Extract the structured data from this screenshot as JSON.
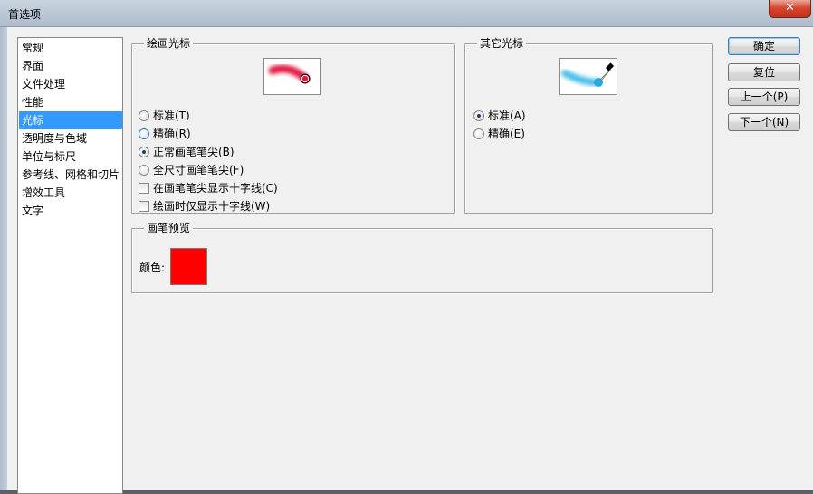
{
  "window": {
    "title": "首选项",
    "close_label": "✕"
  },
  "nav": {
    "items": [
      {
        "label": "常规"
      },
      {
        "label": "界面"
      },
      {
        "label": "文件处理"
      },
      {
        "label": "性能"
      },
      {
        "label": "光标"
      },
      {
        "label": "透明度与色域"
      },
      {
        "label": "单位与标尺"
      },
      {
        "label": "参考线、网格和切片"
      },
      {
        "label": "增效工具"
      },
      {
        "label": "文字"
      }
    ],
    "selected": "光标"
  },
  "painting_cursors": {
    "label": "绘画光标",
    "options": [
      {
        "label": "标准(T)",
        "checked": false
      },
      {
        "label": "精确(R)",
        "checked": false
      },
      {
        "label": "正常画笔笔尖(B)",
        "checked": true
      },
      {
        "label": "全尺寸画笔笔尖(F)",
        "checked": false
      }
    ],
    "checkboxes": [
      {
        "label": "在画笔笔尖显示十字线(C)",
        "checked": false
      },
      {
        "label": "绘画时仅显示十字线(W)",
        "checked": false
      }
    ]
  },
  "other_cursors": {
    "label": "其它光标",
    "options": [
      {
        "label": "标准(A)",
        "checked": true
      },
      {
        "label": "精确(E)",
        "checked": false
      }
    ]
  },
  "brush_preview": {
    "label": "画笔预览",
    "color_label": "颜色:",
    "color": "#ff0000"
  },
  "buttons": {
    "ok": "确定",
    "reset": "复位",
    "prev": "上一个(P)",
    "next": "下一个(N)"
  },
  "colors": {
    "selection": "#3399ff",
    "brush_stroke": "#e2143c",
    "eyedropper_stroke": "#39b6e6"
  }
}
